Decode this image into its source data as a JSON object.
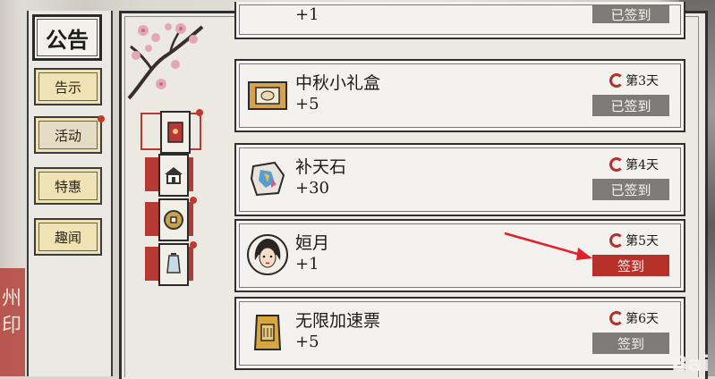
{
  "left_menu": {
    "title": "公告",
    "items": [
      {
        "label": "告示",
        "badge": false
      },
      {
        "label": "活动",
        "badge": true
      },
      {
        "label": "特惠",
        "badge": false
      },
      {
        "label": "趣闻",
        "badge": false
      }
    ]
  },
  "categories": [
    {
      "icon": "red-envelope-icon",
      "badge": true
    },
    {
      "icon": "house-icon",
      "badge": false
    },
    {
      "icon": "coin-icon",
      "badge": true
    },
    {
      "icon": "gourd-icon",
      "badge": true
    }
  ],
  "rows": [
    {
      "name": "",
      "qty": "+1",
      "day": "",
      "button": "已签到",
      "state": "done"
    },
    {
      "name": "中秋小礼盒",
      "qty": "+5",
      "day": "第3天",
      "button": "已签到",
      "state": "done"
    },
    {
      "name": "补天石",
      "qty": "+30",
      "day": "第4天",
      "button": "已签到",
      "state": "done"
    },
    {
      "name": "姮月",
      "qty": "+1",
      "day": "第5天",
      "button": "签到",
      "state": "active"
    },
    {
      "name": "无限加速票",
      "qty": "+5",
      "day": "第6天",
      "button": "签到",
      "state": "todo"
    }
  ],
  "background": {
    "left_text": "州印",
    "watermark": "Bai"
  },
  "colors": {
    "accent_red": "#b8302a",
    "done_gray": "#7d7b77",
    "menu_yellow": "#efe3b5"
  }
}
